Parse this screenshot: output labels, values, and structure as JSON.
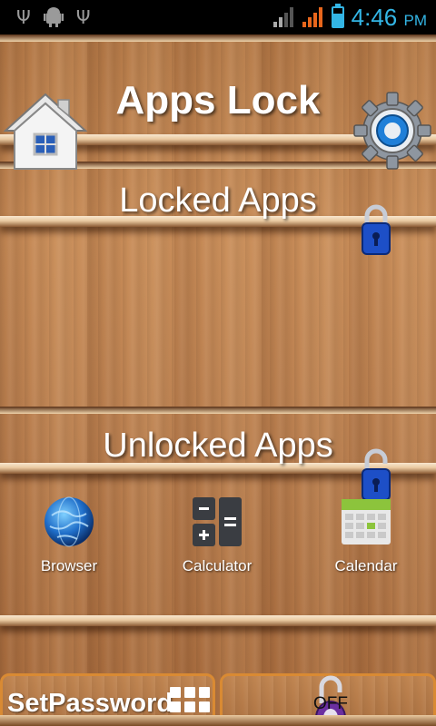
{
  "status_bar": {
    "icons": [
      "usb-icon",
      "android-debug-icon",
      "usb-icon"
    ],
    "time": "4:46",
    "ampm": "PM"
  },
  "header": {
    "title": "Apps Lock",
    "home_icon": "house-icon",
    "settings_icon": "gear-icon"
  },
  "locked_section": {
    "title": "Locked Apps",
    "icon": "lock-closed-icon",
    "apps": []
  },
  "unlocked_section": {
    "title": "Unlocked Apps",
    "icon": "lock-open-icon",
    "apps": [
      {
        "label": "Browser",
        "icon": "globe-icon"
      },
      {
        "label": "Calculator",
        "icon": "calculator-icon"
      },
      {
        "label": "Calendar",
        "icon": "calendar-icon"
      }
    ]
  },
  "footer": {
    "set_password_label": "SetPassword",
    "toggle_label": "OFF"
  },
  "colors": {
    "accent_blue": "#33b5e5",
    "button_border": "#d98a33",
    "wood": "#c88c58"
  }
}
